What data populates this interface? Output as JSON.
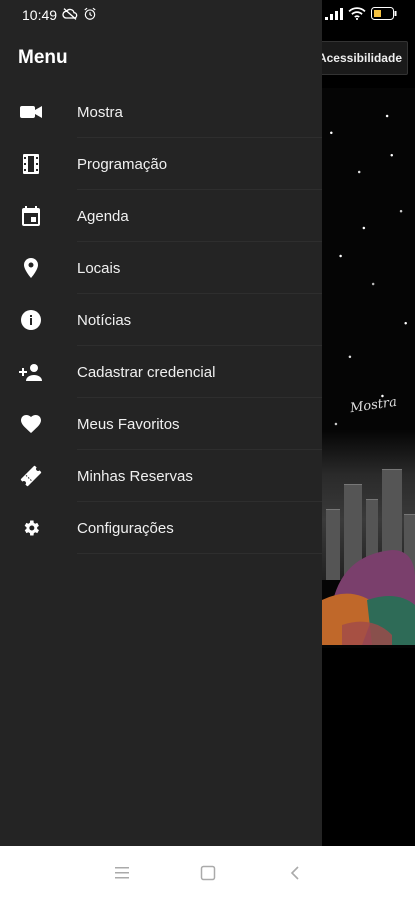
{
  "status_bar": {
    "time": "10:49",
    "icons": [
      "cloud-off-icon",
      "alarm-icon",
      "signal-icon",
      "wifi-icon",
      "battery-icon"
    ],
    "battery_color": "#f5c242"
  },
  "background": {
    "accessibility_button_label": "Acessibilidade",
    "brand_text": "Mostra"
  },
  "drawer": {
    "title": "Menu",
    "items": [
      {
        "label": "Mostra",
        "icon": "videocam-icon"
      },
      {
        "label": "Programação",
        "icon": "film-strip-icon"
      },
      {
        "label": "Agenda",
        "icon": "calendar-icon"
      },
      {
        "label": "Locais",
        "icon": "location-pin-icon"
      },
      {
        "label": "Notícias",
        "icon": "info-icon"
      },
      {
        "label": "Cadastrar credencial",
        "icon": "person-add-icon"
      },
      {
        "label": "Meus Favoritos",
        "icon": "heart-icon"
      },
      {
        "label": "Minhas Reservas",
        "icon": "ticket-icon"
      },
      {
        "label": "Configurações",
        "icon": "gear-icon"
      }
    ]
  },
  "nav_bar": {
    "buttons": [
      "menu-icon",
      "home-square-icon",
      "back-chevron-icon"
    ]
  }
}
